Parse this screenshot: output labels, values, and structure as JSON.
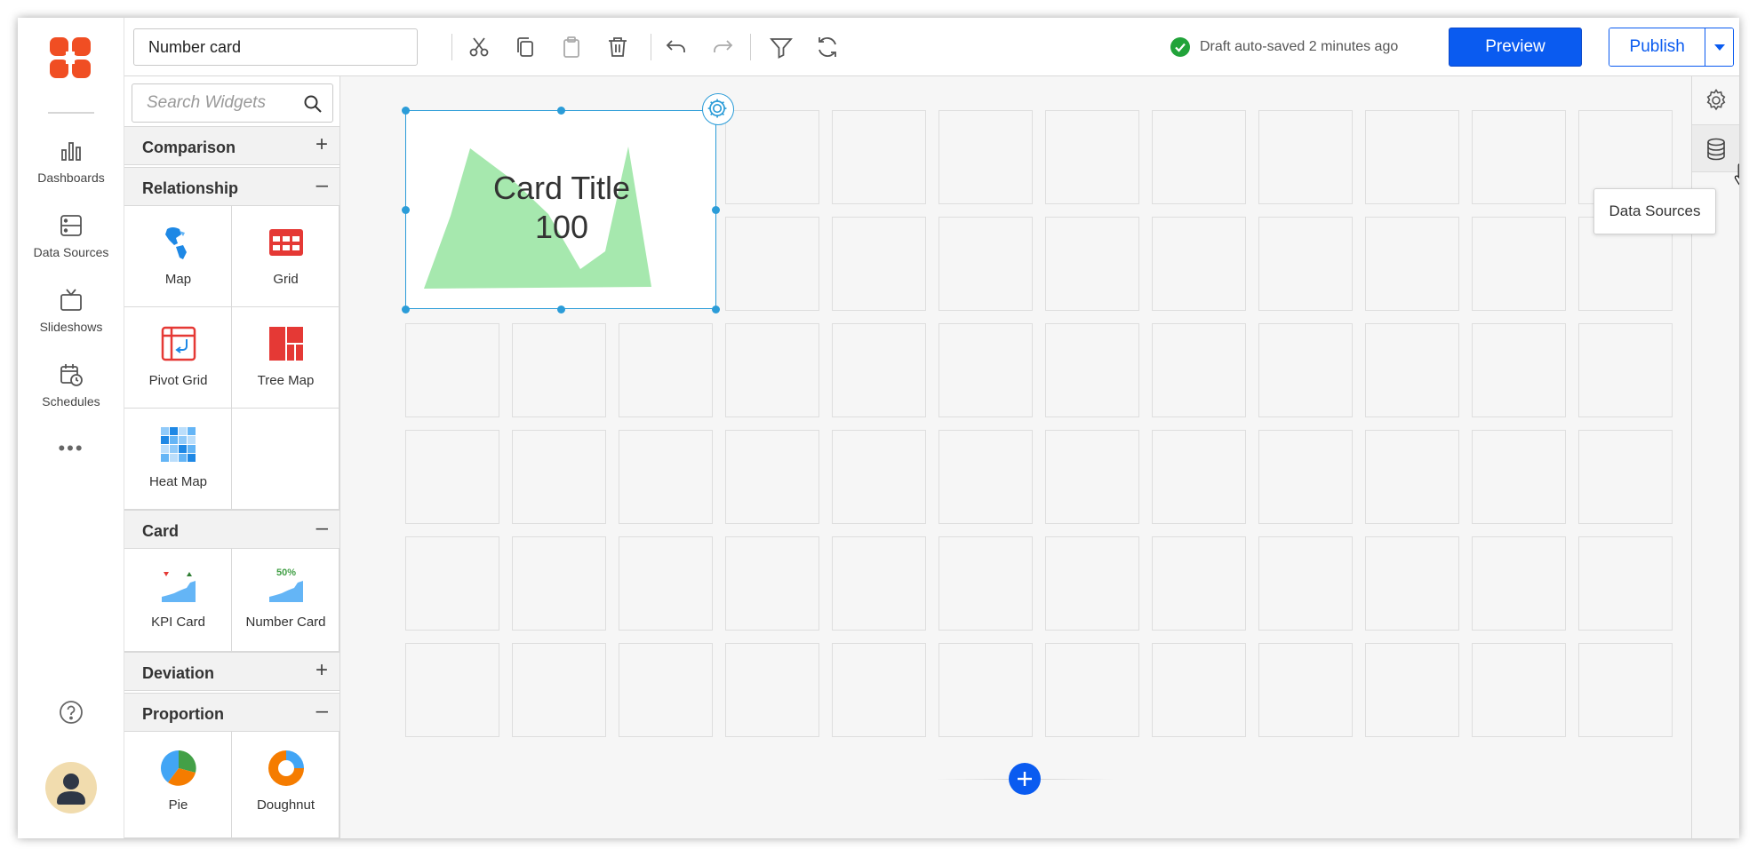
{
  "toolbar": {
    "title_value": "Number card",
    "status_text": "Draft auto-saved 2 minutes ago",
    "preview_label": "Preview",
    "publish_label": "Publish",
    "icons": [
      "cut-icon",
      "copy-icon",
      "paste-icon",
      "delete-icon",
      "undo-icon",
      "redo-icon",
      "filter-icon",
      "refresh-icon"
    ]
  },
  "nav": {
    "items": [
      {
        "label": "Dashboards",
        "icon": "bar-chart-icon"
      },
      {
        "label": "Data Sources",
        "icon": "database-icon"
      },
      {
        "label": "Slideshows",
        "icon": "tv-icon"
      },
      {
        "label": "Schedules",
        "icon": "calendar-clock-icon"
      }
    ],
    "more": "•••"
  },
  "panel": {
    "search_placeholder": "Search Widgets",
    "categories": [
      {
        "label": "Comparison",
        "toggle": "+"
      },
      {
        "label": "Relationship",
        "toggle": "–"
      },
      {
        "label": "Card",
        "toggle": "–"
      },
      {
        "label": "Deviation",
        "toggle": "+"
      },
      {
        "label": "Proportion",
        "toggle": "–"
      }
    ],
    "widgets": {
      "map": "Map",
      "grid": "Grid",
      "pivot_grid": "Pivot Grid",
      "tree_map": "Tree Map",
      "heat_map": "Heat Map",
      "kpi_card": "KPI Card",
      "number_card": "Number Card",
      "number_card_badge": "50%",
      "pie": "Pie",
      "doughnut": "Doughnut"
    }
  },
  "canvas": {
    "widget": {
      "title": "Card Title",
      "value": "100"
    }
  },
  "rail": {
    "tooltip": "Data Sources"
  },
  "colors": {
    "accent": "#0a5bf0",
    "selection": "#2b9cd8",
    "area_fill": "#a6e8ae",
    "success": "#21a33a",
    "brand": "#f04e23"
  }
}
